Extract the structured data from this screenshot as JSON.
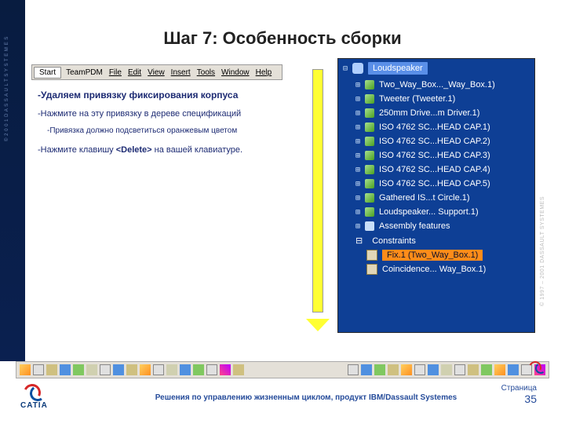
{
  "title": "Шаг 7: Особенность сборки",
  "side_left": "© 2 0 0 1  D A S S A U L T  S Y S T E M E S",
  "menu": {
    "start": "Start",
    "items": [
      "TeamPDM",
      "File",
      "Edit",
      "View",
      "Insert",
      "Tools",
      "Window",
      "Help"
    ]
  },
  "instructions": {
    "main": "-Удаляем привязку фиксирования корпуса",
    "sub1": "-Нажмите на эту привязку в дереве спецификаций",
    "sub2": "-Привязка должно подсветиться оранжевым цветом",
    "sub3_pre": "-Нажмите клавишу ",
    "sub3_key": "<Delete>",
    "sub3_post": " на вашей клавиатуре."
  },
  "tree": {
    "root": "Loudspeaker",
    "items": [
      "Two_Way_Box..._Way_Box.1)",
      "Tweeter (Tweeter.1)",
      "250mm Drive...m Driver.1)",
      "ISO 4762 SC...HEAD CAP.1)",
      "ISO 4762 SC...HEAD CAP.2)",
      "ISO 4762 SC...HEAD CAP.3)",
      "ISO 4762 SC...HEAD CAP.4)",
      "ISO 4762 SC...HEAD CAP.5)",
      "Gathered IS...t Circle.1)",
      "Loudspeaker... Support.1)",
      "Assembly features"
    ],
    "constraints_label": "Constraints",
    "fix": "Fix.1 (Two_Way_Box.1)",
    "coincidence": "Coincidence... Way_Box.1)"
  },
  "copyright_right": "© 1997 – 2001 DASSAULT SYSTEMES",
  "footer": "Решения по управлению жизненным циклом, продукт IBM/Dassault Systemes",
  "page_label": "Страница",
  "page_number": "35",
  "logo_text": "CATIA"
}
